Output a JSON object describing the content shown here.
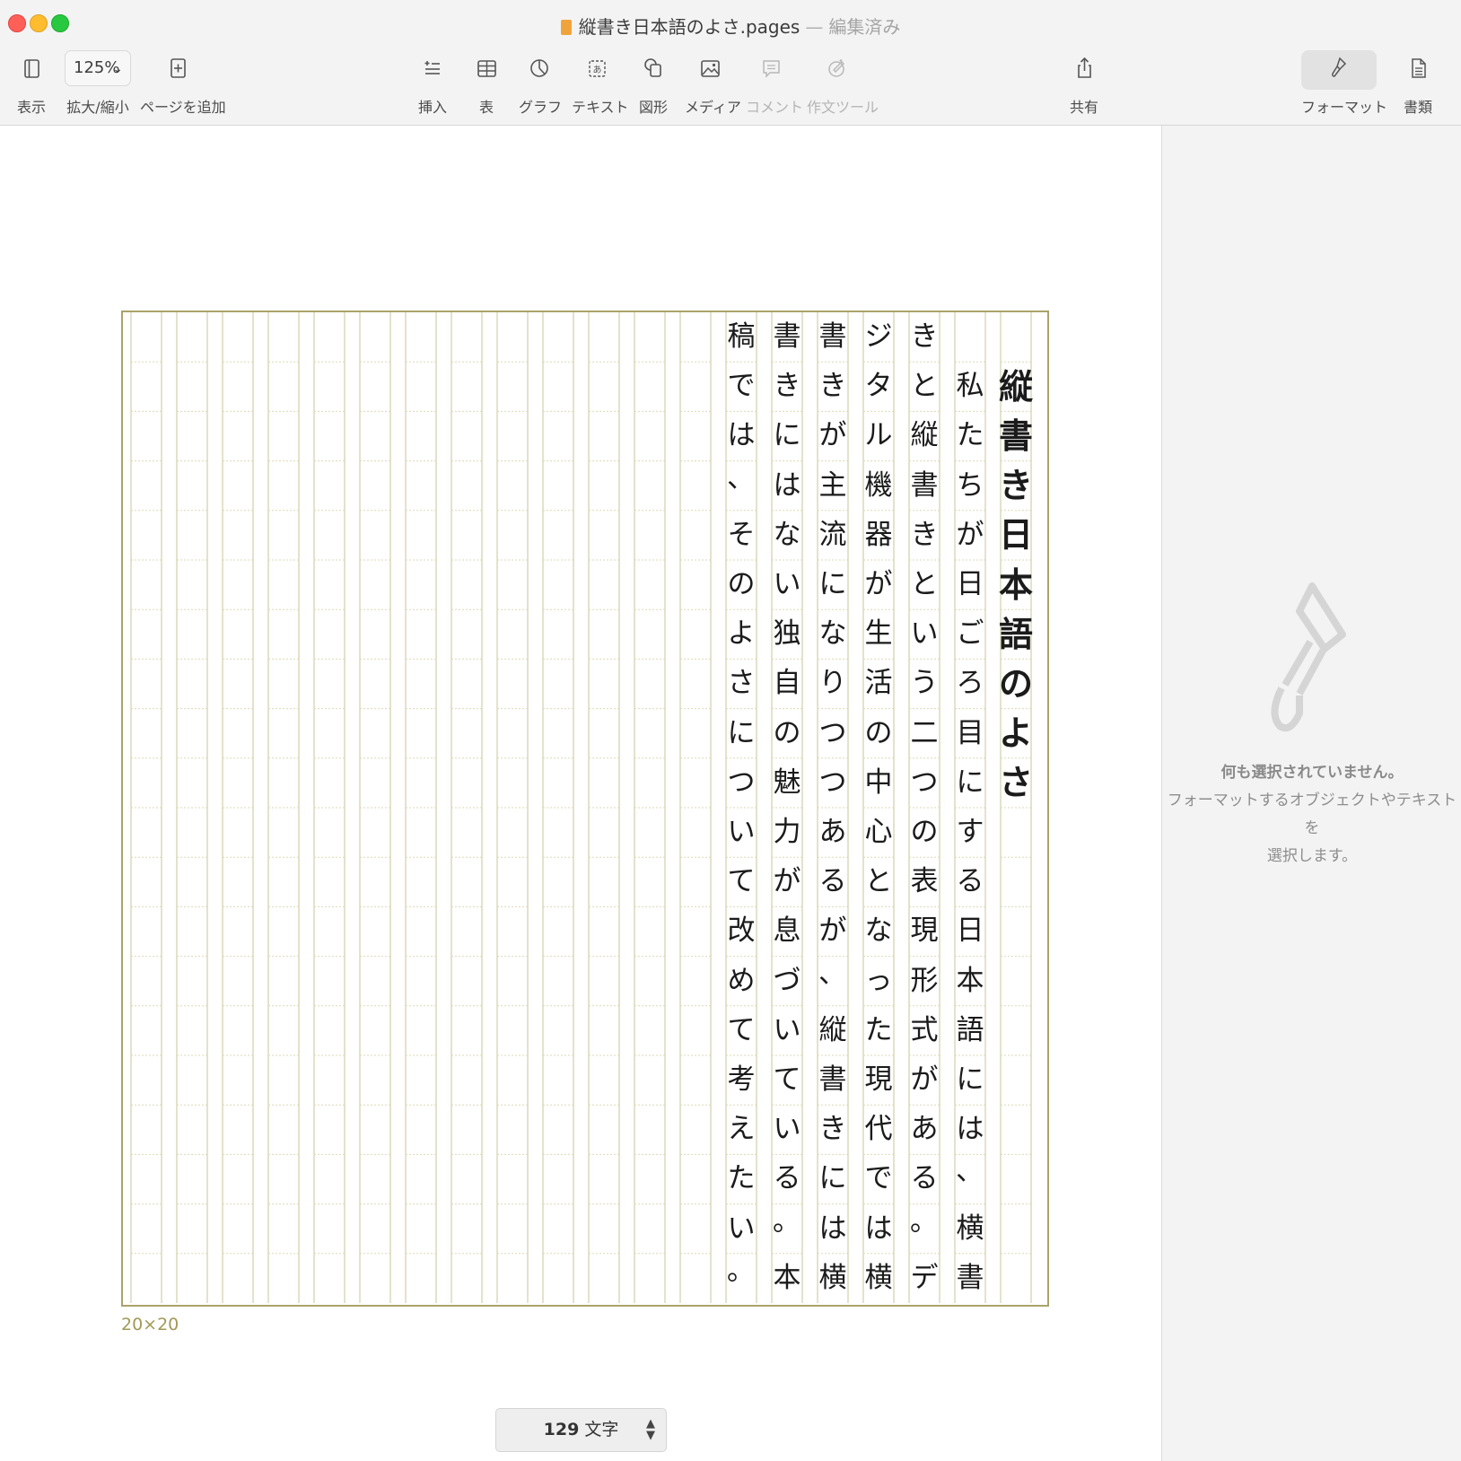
{
  "window": {
    "title": "縦書き日本語のよさ.pages",
    "separator": "—",
    "status": "編集済み"
  },
  "toolbar": {
    "view_label": "表示",
    "zoom_value": "125%",
    "zoom_label": "拡大/縮小",
    "add_page_label": "ページを追加",
    "insert_label": "挿入",
    "table_label": "表",
    "chart_label": "グラフ",
    "text_label": "テキスト",
    "shape_label": "図形",
    "media_label": "メディア",
    "comment_label": "コメント",
    "writing_tools_label": "作文ツール",
    "share_label": "共有",
    "format_label": "フォーマット",
    "document_label": "書類"
  },
  "document": {
    "grid_size": "20×20",
    "columns": [
      "　縦書き日本語のよさ",
      "　私たちが日ごろ目にする日本語には、横書",
      "きと縦書きという二つの表現形式がある。デ",
      "ジタル機器が生活の中心となった現代では横",
      "書きが主流になりつつあるが、縦書きには横",
      "書きにはない独自の魅力が息づいている。本",
      "稿では、そのよさについて改めて考えたい。"
    ]
  },
  "status_bar": {
    "count": "129",
    "unit": "文字"
  },
  "inspector": {
    "empty_title": "何も選択されていません。",
    "empty_line1": "フォーマットするオブジェクトやテキストを",
    "empty_line2": "選択します。"
  }
}
